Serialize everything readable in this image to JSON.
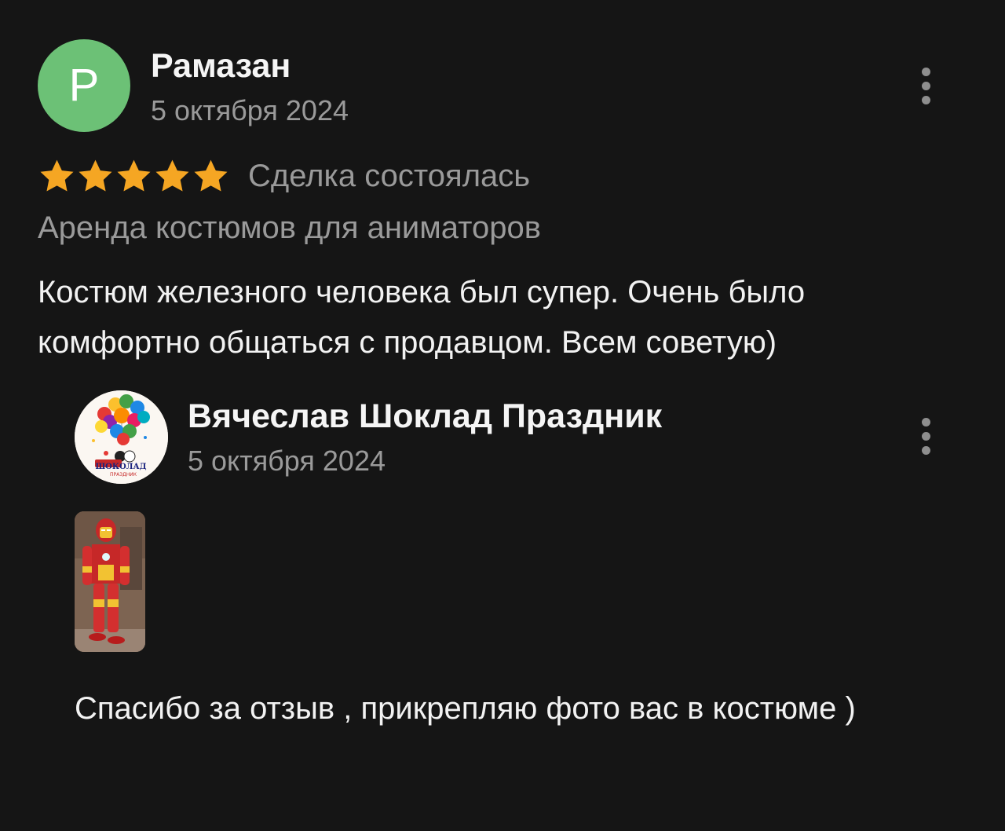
{
  "review": {
    "author_initial": "Р",
    "author_name": "Рамазан",
    "date": "5 октября 2024",
    "rating": 5,
    "deal_status": "Сделка состоялась",
    "category": "Аренда костюмов для аниматоров",
    "text": "Костюм железного человека был супер. Очень было комфортно общаться с продавцом. Всем советую)"
  },
  "reply": {
    "author_name": "Вячеслав Шоклад Праздник",
    "date": "5 октября 2024",
    "avatar_logo_text": "ШОКОЛАД ПРАЗДНИК",
    "text": "Спасибо за отзыв , прикрепляю фото вас в костюме )"
  },
  "colors": {
    "background": "#151515",
    "avatar_green": "#6cc176",
    "star": "#f5a623",
    "muted_text": "#9a9a9a",
    "primary_text": "#f2f2f2"
  },
  "icons": {
    "more": "kebab-vertical-icon",
    "star": "star-icon"
  }
}
